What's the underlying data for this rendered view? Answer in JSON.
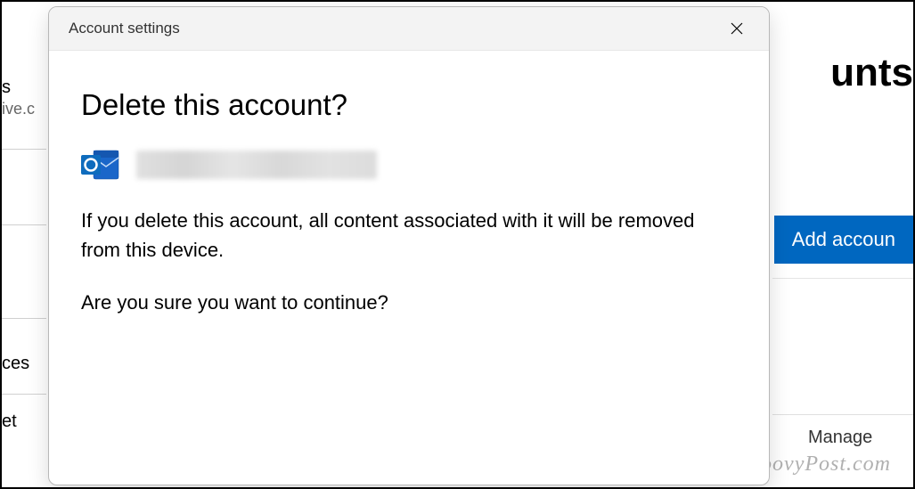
{
  "background": {
    "page_title_fragment": "unts",
    "sidebar": {
      "text1": "s",
      "text2": "ive.c",
      "text3": "ces",
      "text4": "et"
    },
    "add_button_label": "Add accoun",
    "manage_button_label": "Manage"
  },
  "modal": {
    "header_title": "Account settings",
    "heading": "Delete this account?",
    "warning_text": "If you delete this account, all content associated with it will be removed from this device.",
    "confirm_text": "Are you sure you want to continue?"
  },
  "watermark": "groovyPost.com"
}
